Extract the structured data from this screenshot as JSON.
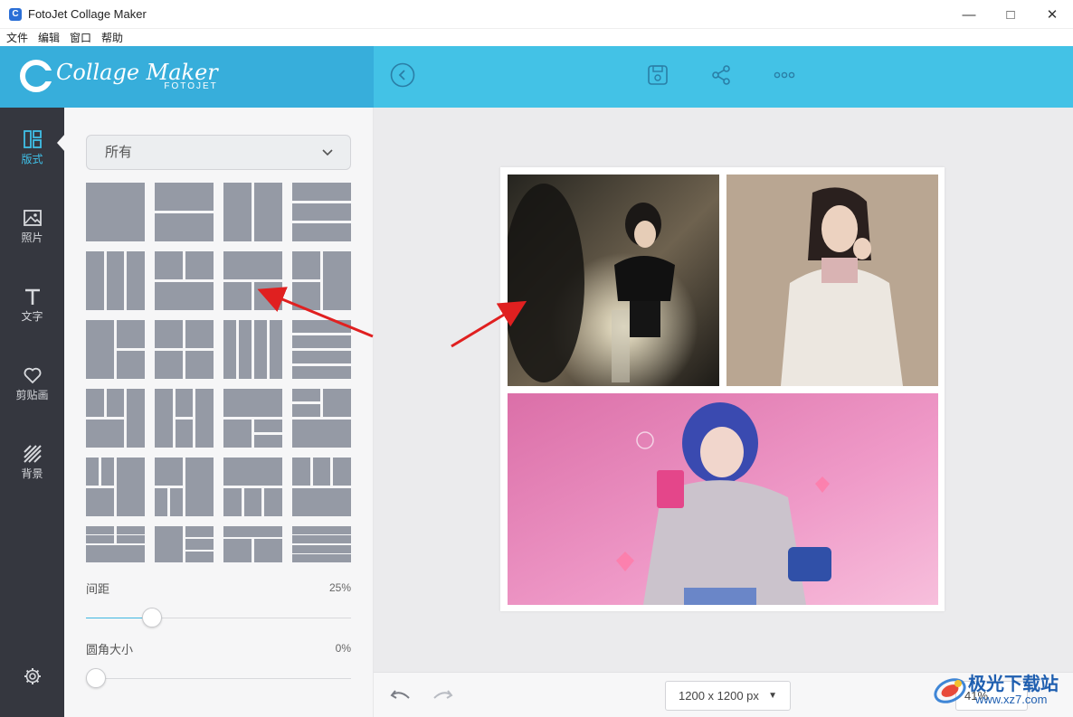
{
  "window": {
    "title": "FotoJet Collage Maker",
    "app_icon": "fotojet-logo-icon",
    "controls": [
      "minimize-icon",
      "maximize-icon",
      "close-icon"
    ]
  },
  "menu": {
    "items": [
      "文件",
      "编辑",
      "窗口",
      "帮助"
    ]
  },
  "header": {
    "logo_text": "Collage Maker",
    "logo_subtext": "FOTOJET",
    "buttons": [
      "back-circle-icon",
      "save-icon",
      "share-icon",
      "more-icon"
    ]
  },
  "sidebar": {
    "items": [
      {
        "label": "版式",
        "icon": "layout-icon",
        "active": true
      },
      {
        "label": "照片",
        "icon": "photo-icon",
        "active": false
      },
      {
        "label": "文字",
        "icon": "text-icon",
        "active": false
      },
      {
        "label": "剪贴画",
        "icon": "heart-icon",
        "active": false
      },
      {
        "label": "背景",
        "icon": "background-stripes-icon",
        "active": false
      }
    ],
    "settings_icon": "gear-icon"
  },
  "panel": {
    "filter_dropdown": {
      "selected": "所有"
    },
    "spacing": {
      "label": "间距",
      "value": "25%",
      "level": 0.25
    },
    "corner": {
      "label": "圆角大小",
      "value": "0%",
      "level": 0.0
    }
  },
  "collage": {
    "photos": [
      {
        "name": "woman-black-dress-mirror-photo",
        "palette": [
          "#2c2a25",
          "#8a7d68",
          "#e9dfc2"
        ]
      },
      {
        "name": "woman-white-coat-photo",
        "palette": [
          "#b8a592",
          "#ebe6df",
          "#2b2120"
        ]
      },
      {
        "name": "blue-hair-3d-character-photo",
        "palette": [
          "#e37fb2",
          "#f4b6d6",
          "#3a46a7"
        ]
      }
    ]
  },
  "bottombar": {
    "canvas_size": "1200 x 1200 px",
    "zoom": "41%",
    "undo_icon": "undo-icon",
    "redo_icon": "redo-icon"
  },
  "watermark": {
    "text_cn": "极光下载站",
    "text_url": "www.xz7.com"
  },
  "colors": {
    "header_left": "#37aedb",
    "header_right": "#43c2e6",
    "sidebar": "#35373f",
    "accent": "#3fc0e8",
    "template_gray": "#959aa5",
    "annotation_arrow": "#e02020"
  }
}
